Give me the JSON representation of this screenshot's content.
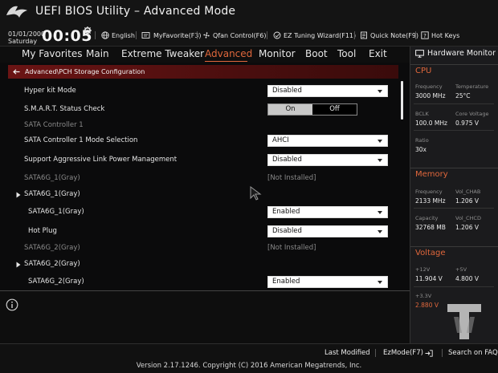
{
  "header": {
    "title": "UEFI BIOS Utility – Advanced Mode",
    "date": "01/01/2000",
    "day": "Saturday",
    "time": "00:05"
  },
  "toolbar": [
    {
      "label": "English",
      "icon": "globe-icon"
    },
    {
      "label": "MyFavorite(F3)",
      "icon": "favorite-icon"
    },
    {
      "label": "Qfan Control(F6)",
      "icon": "fan-icon"
    },
    {
      "label": "EZ Tuning Wizard(F11)",
      "icon": "wizard-icon"
    },
    {
      "label": "Quick Note(F9)",
      "icon": "note-icon"
    },
    {
      "label": "Hot Keys",
      "icon": "help-icon"
    }
  ],
  "menu": [
    {
      "label": "My Favorites"
    },
    {
      "label": "Main"
    },
    {
      "label": "Extreme Tweaker"
    },
    {
      "label": "Advanced",
      "active": true
    },
    {
      "label": "Monitor"
    },
    {
      "label": "Boot"
    },
    {
      "label": "Tool"
    },
    {
      "label": "Exit"
    }
  ],
  "breadcrumb": "Advanced\\PCH Storage Configuration",
  "settings": [
    {
      "label": "Hyper kit Mode",
      "type": "dropdown",
      "value": "Disabled"
    },
    {
      "label": "S.M.A.R.T. Status Check",
      "type": "toggle",
      "on": "On",
      "off": "Off"
    },
    {
      "label": "SATA Controller 1",
      "type": "header"
    },
    {
      "label": "SATA Controller 1 Mode Selection",
      "type": "dropdown",
      "value": "AHCI"
    },
    {
      "label": "Support Aggressive Link Power Management",
      "type": "dropdown",
      "value": "Disabled"
    },
    {
      "label": "SATA6G_1(Gray)",
      "type": "info",
      "value": "[Not Installed]"
    },
    {
      "label": "SATA6G_1(Gray)",
      "type": "submenu"
    },
    {
      "label": "SATA6G_1(Gray)",
      "type": "dropdown",
      "value": "Enabled",
      "indent": true
    },
    {
      "label": "Hot Plug",
      "type": "dropdown",
      "value": "Disabled",
      "indent": true
    },
    {
      "label": "SATA6G_2(Gray)",
      "type": "info",
      "value": "[Not Installed]"
    },
    {
      "label": "SATA6G_2(Gray)",
      "type": "submenu"
    },
    {
      "label": "SATA6G_2(Gray)",
      "type": "dropdown",
      "value": "Enabled",
      "indent": true
    }
  ],
  "hardware_monitor": {
    "title": "Hardware Monitor",
    "cpu": {
      "title": "CPU",
      "frequency_label": "Frequency",
      "frequency": "3000 MHz",
      "temperature_label": "Temperature",
      "temperature": "25°C",
      "bclk_label": "BCLK",
      "bclk": "100.0 MHz",
      "core_voltage_label": "Core Voltage",
      "core_voltage": "0.975 V",
      "ratio_label": "Ratio",
      "ratio": "30x"
    },
    "memory": {
      "title": "Memory",
      "frequency_label": "Frequency",
      "frequency": "2133 MHz",
      "vol_chab_label": "Vol_CHAB",
      "vol_chab": "1.206 V",
      "capacity_label": "Capacity",
      "capacity": "32768 MB",
      "vol_chcd_label": "Vol_CHCD",
      "vol_chcd": "1.206 V"
    },
    "voltage": {
      "title": "Voltage",
      "v12_label": "+12V",
      "v12": "11.904 V",
      "v5_label": "+5V",
      "v5": "4.800 V",
      "v33_label": "+3.3V",
      "v33": "2.880 V"
    }
  },
  "footer": {
    "last_modified": "Last Modified",
    "ez_mode": "EzMode(F7)",
    "search_faq": "Search on FAQ",
    "version": "Version 2.17.1246. Copyright (C) 2016 American Megatrends, Inc."
  },
  "colors": {
    "accent": "#e0673c",
    "breadcrumb": "#6b1414"
  }
}
